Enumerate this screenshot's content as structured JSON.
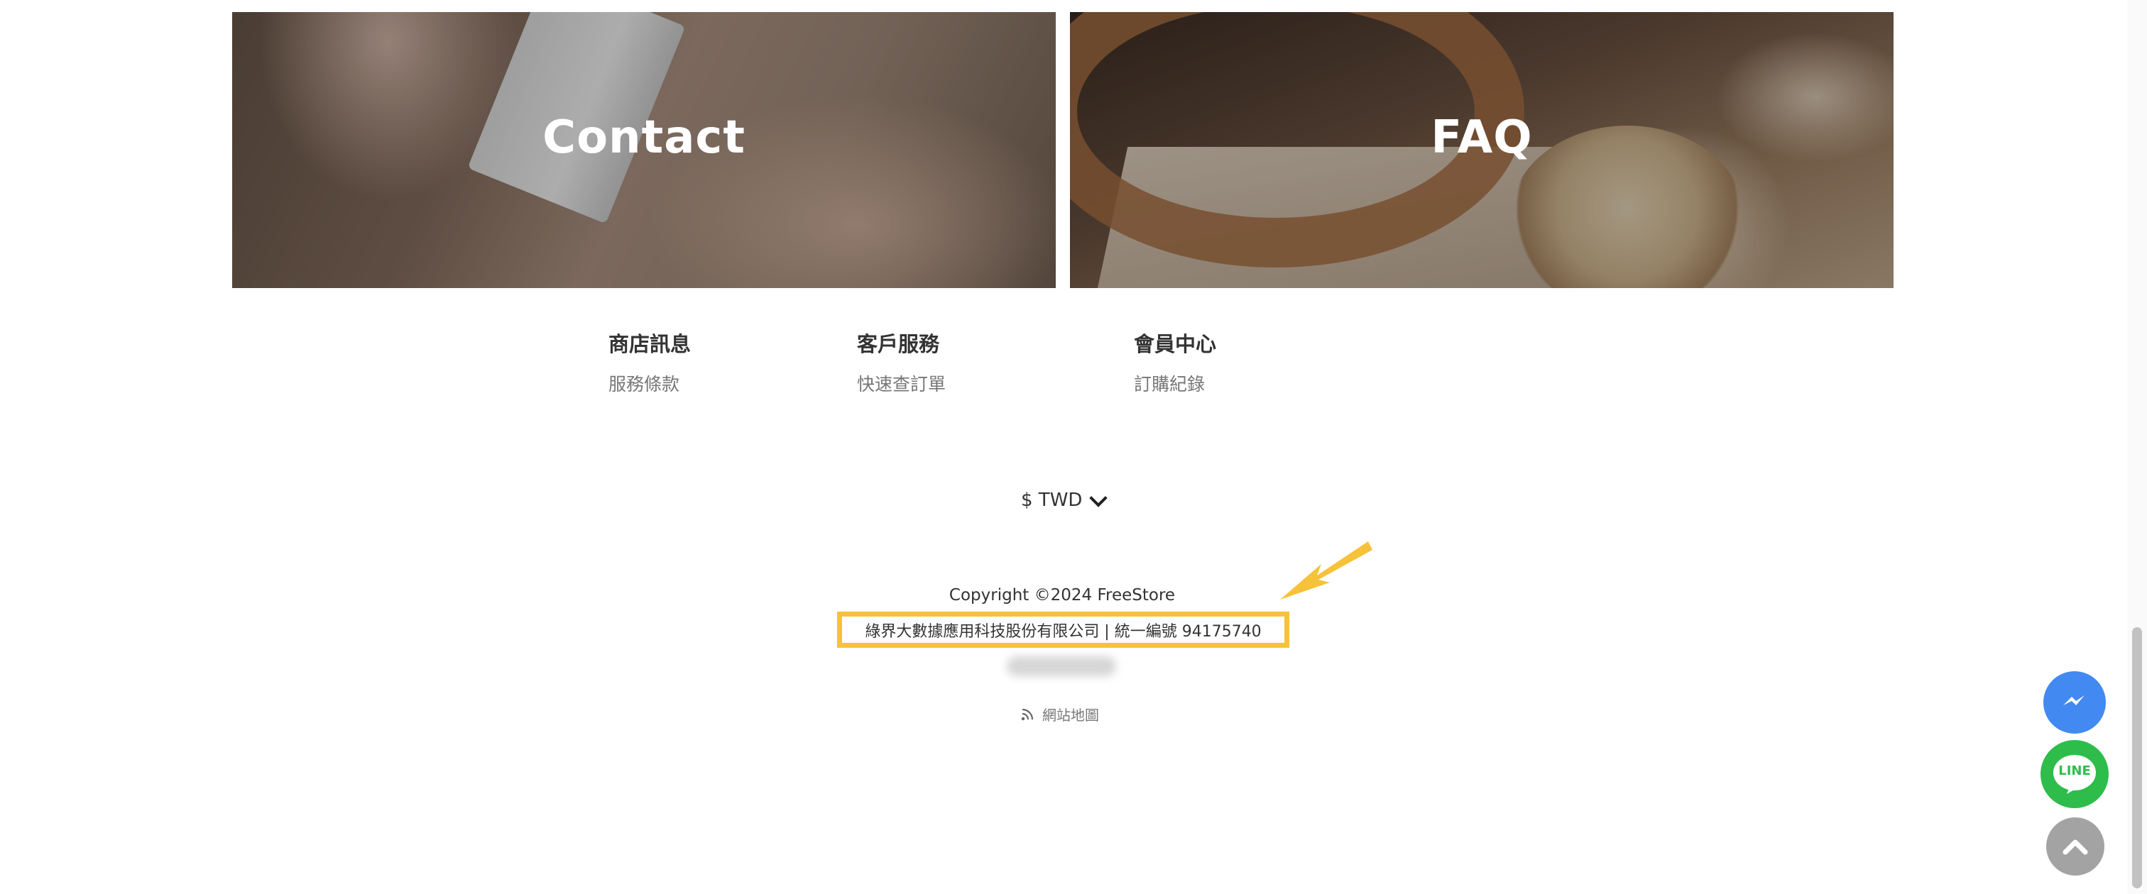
{
  "banners": {
    "contact": "Contact",
    "faq": "FAQ"
  },
  "footer": {
    "columns": [
      {
        "heading": "商店訊息",
        "link": "服務條款"
      },
      {
        "heading": "客戶服務",
        "link": "快速查訂單"
      },
      {
        "heading": "會員中心",
        "link": "訂購紀錄"
      }
    ]
  },
  "currency": {
    "label": "$ TWD",
    "icon": "chevron-down-icon"
  },
  "copyright": "Copyright ©2024 FreeStore",
  "company_info": "綠界大數據應用科技股份有限公司 | 統一編號 94175740",
  "sitemap": {
    "label": "網站地圖",
    "icon": "rss-icon"
  },
  "floating_buttons": {
    "line_label": "LINE"
  },
  "colors": {
    "highlight": "#f6c23a",
    "messenger": "#4289f2",
    "line": "#2ebd4b",
    "back_to_top": "#a3a3a3"
  }
}
